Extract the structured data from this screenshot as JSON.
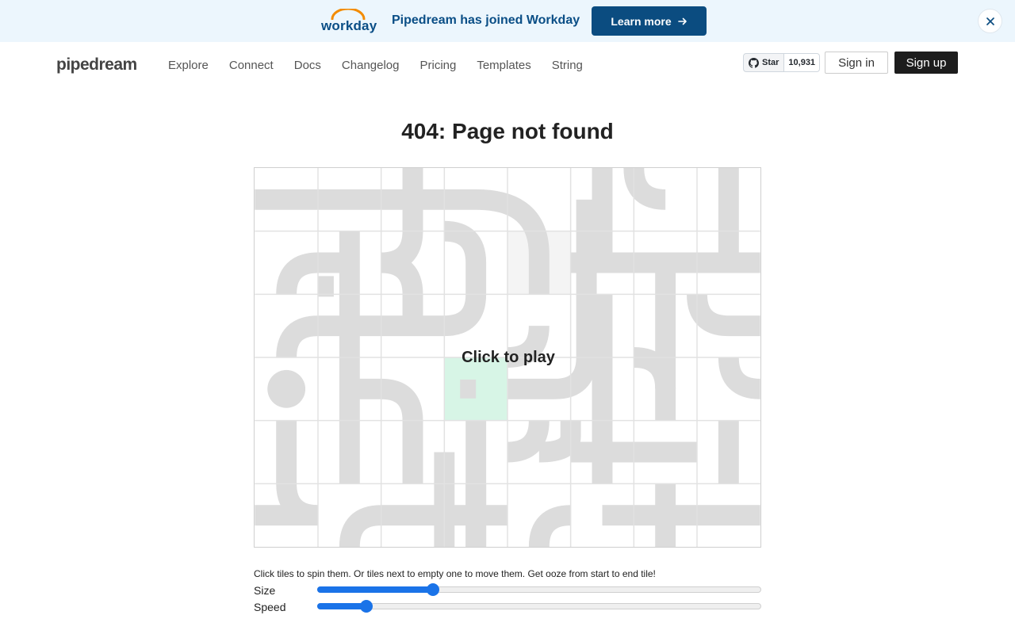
{
  "banner": {
    "logo_text": "workday",
    "message": "Pipedream has joined Workday",
    "cta_label": "Learn more",
    "close_icon": "close-icon",
    "colors": {
      "background": "#ecf6fd",
      "text": "#0a4e86",
      "button": "#0b4c80",
      "logo_arc": "#f38b00"
    }
  },
  "header": {
    "brand": "pipedream",
    "nav": [
      "Explore",
      "Connect",
      "Docs",
      "Changelog",
      "Pricing",
      "Templates",
      "String"
    ],
    "github": {
      "icon": "github-icon",
      "star_label": "Star",
      "count": "10,931"
    },
    "sign_in": "Sign in",
    "sign_up": "Sign up"
  },
  "main": {
    "title": "404: Page not found",
    "game": {
      "overlay_label": "Click to play",
      "grid": {
        "cols": 8,
        "rows": 6
      },
      "empty_tile": {
        "col": 4,
        "row": 1
      },
      "start_tile": {
        "col": 3,
        "row": 3
      },
      "colors": {
        "pipe": "#dcdcdc",
        "empty": "#f4f4f4",
        "start": "#d7f5e6",
        "grid_line": "#e2e2e2"
      }
    },
    "instructions": "Click tiles to spin them. Or tiles next to empty one to move them. Get ooze from start to end tile!",
    "controls": [
      {
        "label": "Size",
        "value": 0.26
      },
      {
        "label": "Speed",
        "value": 0.11
      }
    ],
    "colors": {
      "slider_accent": "#1a73e8"
    }
  }
}
